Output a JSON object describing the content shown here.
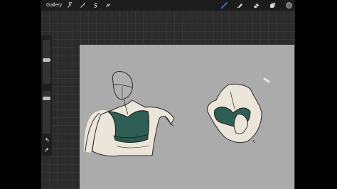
{
  "toolbar": {
    "gallery_label": "Gallery",
    "left_icons": [
      "wrench-icon",
      "magic-wand-icon",
      "selection-icon",
      "transform-arrow-icon"
    ],
    "right_icons": [
      "brush-icon",
      "smudge-icon",
      "eraser-icon",
      "layers-icon"
    ],
    "active_tool": "brush",
    "active_color": "#3b7fd9",
    "current_color": "#6e6e6e"
  },
  "sidebar": {
    "brush_size_level": 0.55,
    "opacity_level": 0.85,
    "buttons": [
      "modify-square-icon",
      "undo-icon",
      "redo-icon"
    ]
  },
  "canvas": {
    "background": "#ababab",
    "skin_color": "#ece5da",
    "top_color": "#2e5e54",
    "line_color": "#2a2a2a"
  }
}
